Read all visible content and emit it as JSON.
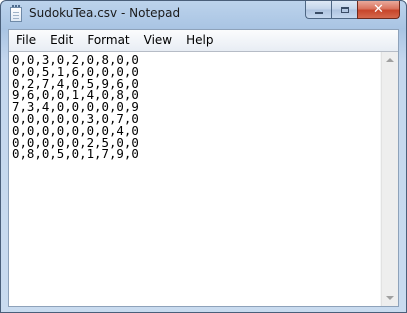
{
  "window": {
    "title": "SudokuTea.csv - Notepad",
    "app_icon": "notepad-icon"
  },
  "caption_buttons": {
    "close_glyph": "✕"
  },
  "menu": {
    "items": [
      {
        "label": "File"
      },
      {
        "label": "Edit"
      },
      {
        "label": "Format"
      },
      {
        "label": "View"
      },
      {
        "label": "Help"
      }
    ]
  },
  "editor": {
    "lines": [
      "0,0,3,0,2,0,8,0,0",
      "0,0,5,1,6,0,0,0,0",
      "0,2,7,4,0,5,9,6,0",
      "9,6,0,0,1,4,0,8,0",
      "7,3,4,0,0,0,0,0,9",
      "0,0,0,0,0,3,0,7,0",
      "0,0,0,0,0,0,0,4,0",
      "0,0,0,0,0,2,5,0,0",
      "0,8,0,5,0,1,7,9,0"
    ]
  },
  "colors": {
    "close_button": "#c7452a",
    "frame": "#a9c4e3"
  }
}
